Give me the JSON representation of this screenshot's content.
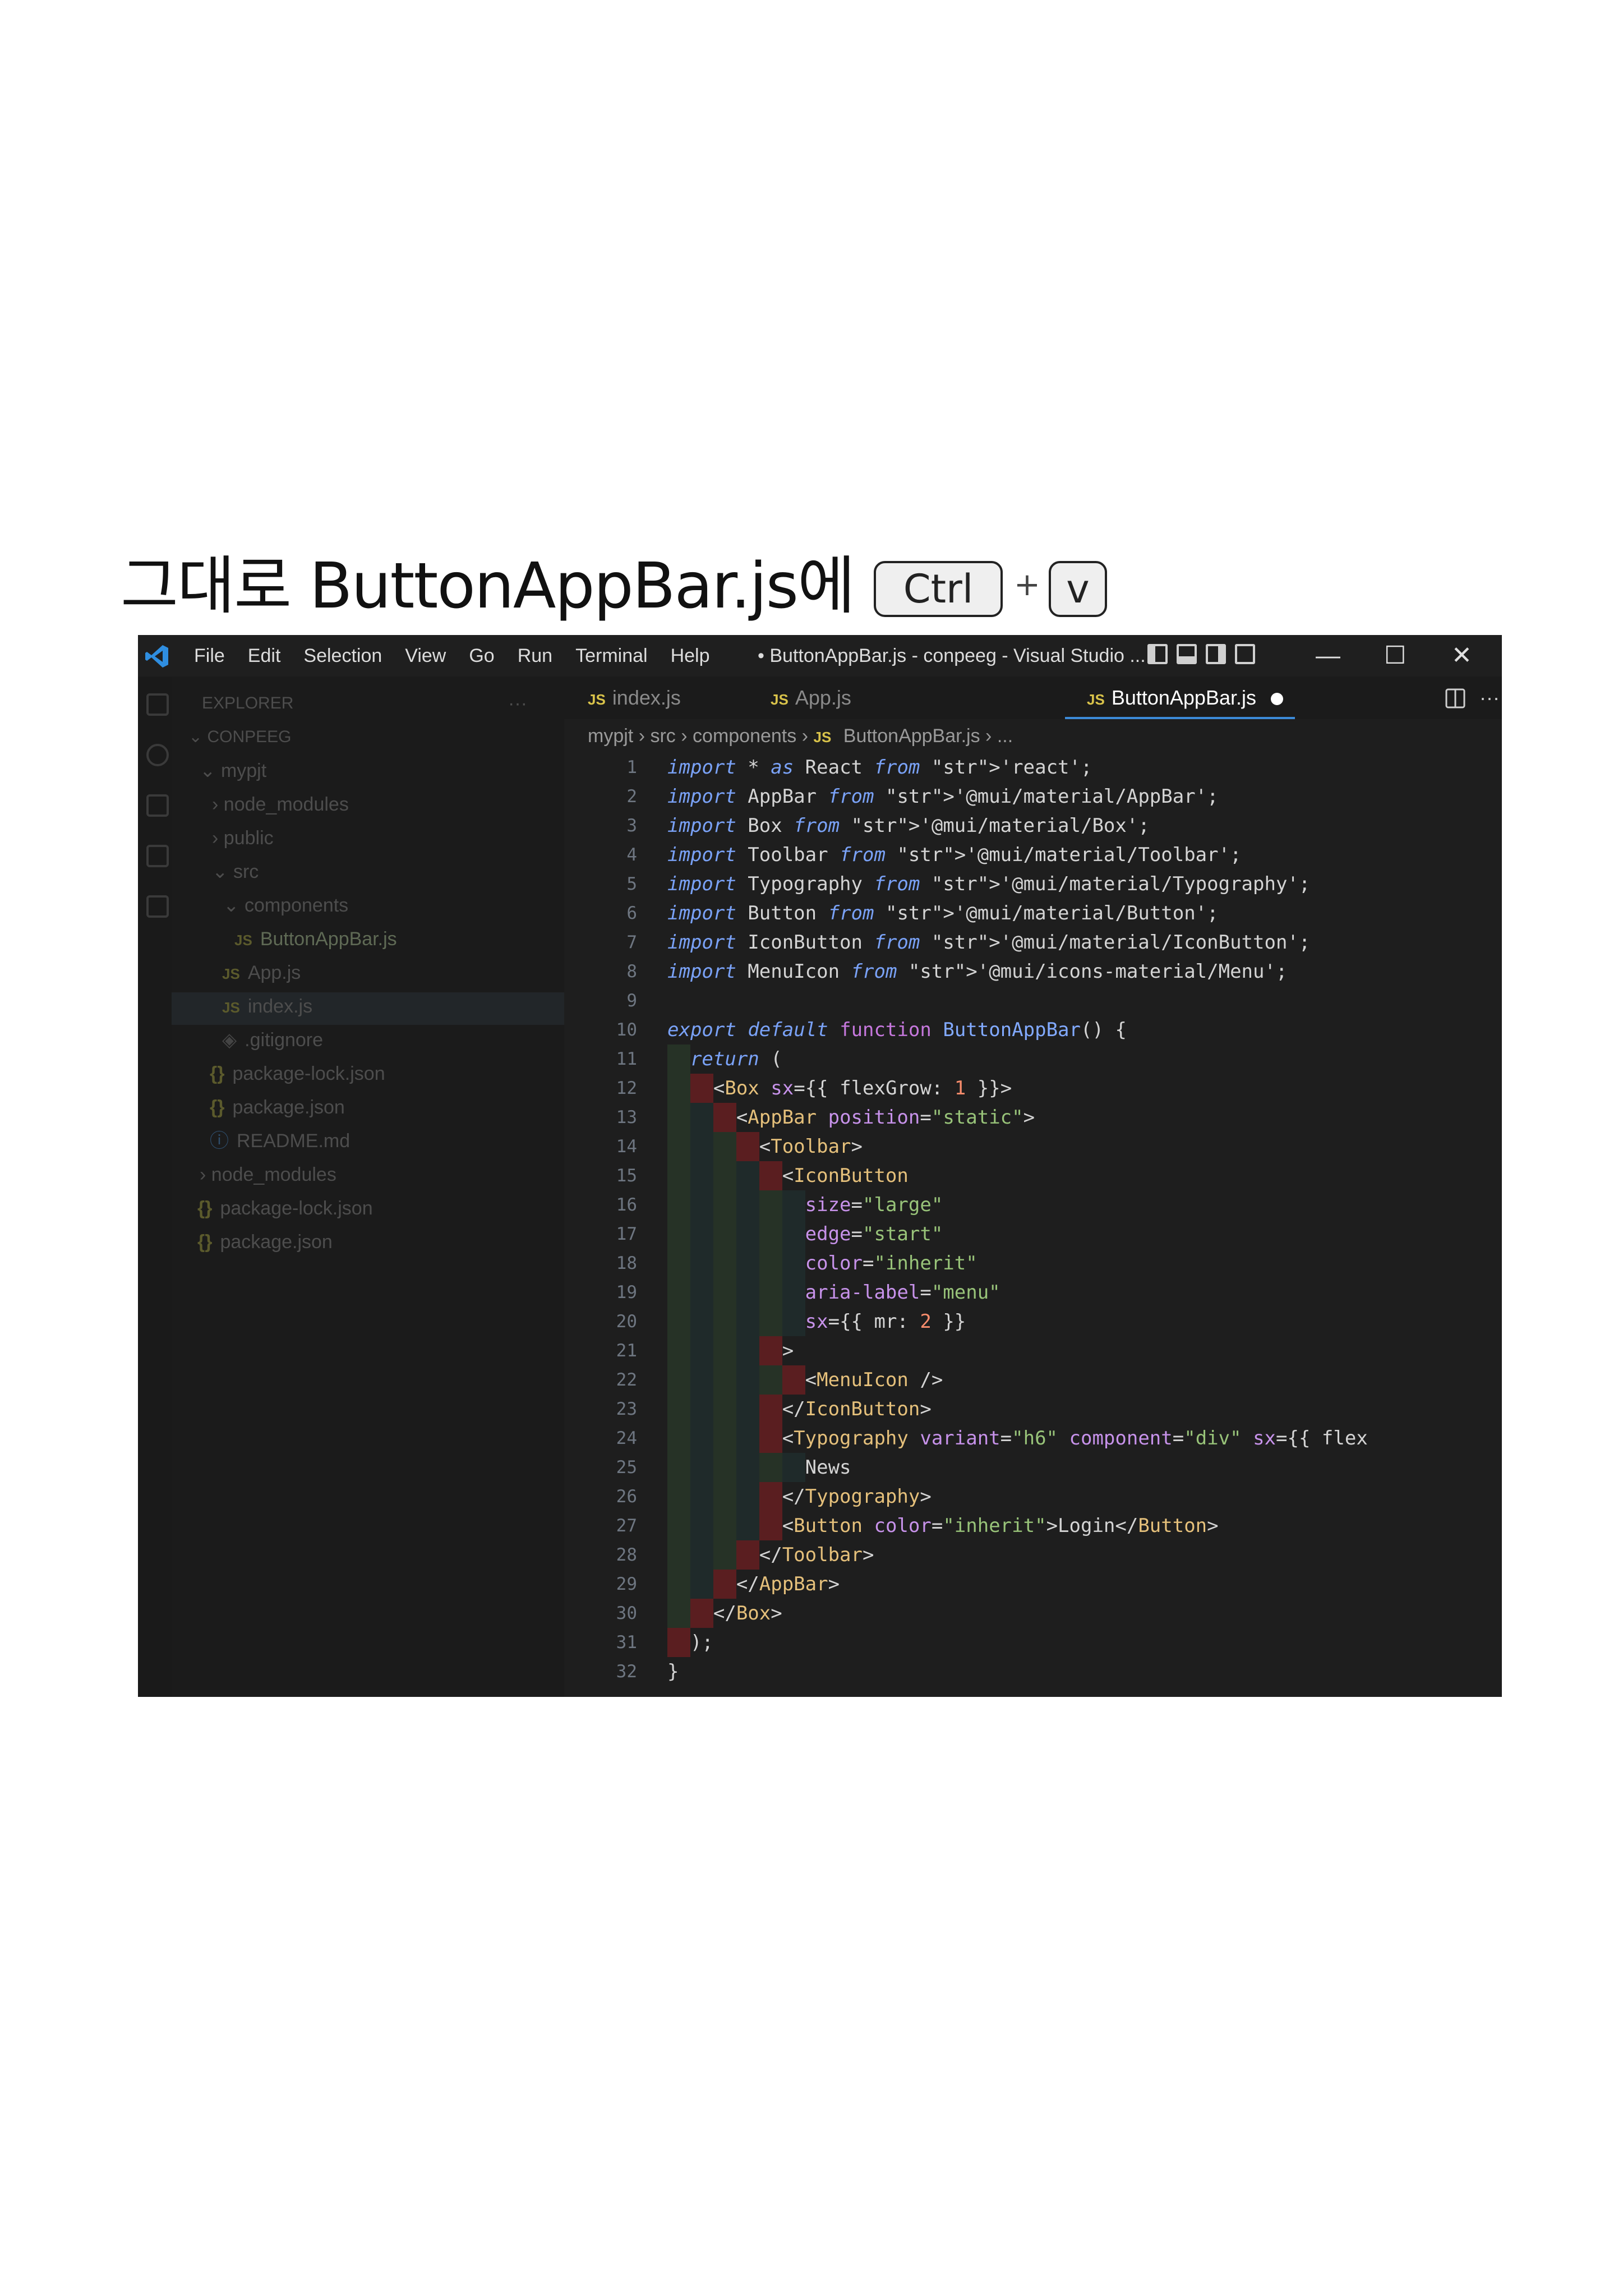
{
  "heading": {
    "text": "그대로 ButtonAppBar.js에",
    "key_ctrl": "Ctrl",
    "plus": "+",
    "key_v": "v"
  },
  "titlebar": {
    "menu": [
      "File",
      "Edit",
      "Selection",
      "View",
      "Go",
      "Run",
      "Terminal",
      "Help"
    ],
    "title": "• ButtonAppBar.js - conpeeg - Visual Studio ...",
    "minimize": "—",
    "maximize": "☐",
    "close": "✕"
  },
  "sidebar": {
    "header": "EXPLORER",
    "more": "···",
    "tree": [
      {
        "label": "CONPEEG",
        "prefix": "⌄"
      },
      {
        "label": "mypjt",
        "prefix": "⌄"
      },
      {
        "label": "node_modules",
        "prefix": "›"
      },
      {
        "label": "public",
        "prefix": "›"
      },
      {
        "label": "src",
        "prefix": "⌄"
      },
      {
        "label": "components",
        "prefix": "⌄"
      },
      {
        "label": "ButtonAppBar.js",
        "prefix": "JS"
      },
      {
        "label": "App.js",
        "prefix": "JS"
      },
      {
        "label": "index.js",
        "prefix": "JS"
      },
      {
        "label": ".gitignore",
        "prefix": "◈"
      },
      {
        "label": "package-lock.json",
        "prefix": "{}"
      },
      {
        "label": "package.json",
        "prefix": "{}"
      },
      {
        "label": "README.md",
        "prefix": "ⓘ"
      },
      {
        "label": "node_modules",
        "prefix": "›"
      },
      {
        "label": "package-lock.json",
        "prefix": "{}"
      },
      {
        "label": "package.json",
        "prefix": "{}"
      }
    ]
  },
  "tabs": [
    {
      "label": "index.js",
      "icon": "JS"
    },
    {
      "label": "App.js",
      "icon": "JS"
    },
    {
      "label": "ButtonAppBar.js",
      "icon": "JS"
    }
  ],
  "breadcrumb": {
    "parts": [
      "mypjt",
      "src",
      "components"
    ],
    "file_icon": "JS",
    "file": "ButtonAppBar.js",
    "tail": "..."
  },
  "editor": {
    "line_numbers": [
      "1",
      "2",
      "3",
      "4",
      "5",
      "6",
      "7",
      "8",
      "9",
      "10",
      "11",
      "12",
      "13",
      "14",
      "15",
      "16",
      "17",
      "18",
      "19",
      "20",
      "21",
      "22",
      "23",
      "24",
      "25",
      "26",
      "27",
      "28",
      "29",
      "30",
      "31",
      "32"
    ],
    "lines": [
      "import * as React from 'react';",
      "import AppBar from '@mui/material/AppBar';",
      "import Box from '@mui/material/Box';",
      "import Toolbar from '@mui/material/Toolbar';",
      "import Typography from '@mui/material/Typography';",
      "import Button from '@mui/material/Button';",
      "import IconButton from '@mui/material/IconButton';",
      "import MenuIcon from '@mui/icons-material/Menu';",
      "",
      "export default function ButtonAppBar() {",
      "  return (",
      "    <Box sx={{ flexGrow: 1 }}>",
      "      <AppBar position=\"static\">",
      "        <Toolbar>",
      "          <IconButton",
      "            size=\"large\"",
      "            edge=\"start\"",
      "            color=\"inherit\"",
      "            aria-label=\"menu\"",
      "            sx={{ mr: 2 }}",
      "          >",
      "            <MenuIcon />",
      "          </IconButton>",
      "          <Typography variant=\"h6\" component=\"div\" sx={{ flex",
      "            News",
      "          </Typography>",
      "          <Button color=\"inherit\">Login</Button>",
      "        </Toolbar>",
      "      </AppBar>",
      "    </Box>",
      "  );",
      "}"
    ]
  },
  "colors": {
    "window_bg": "#1e1e1e",
    "accent": "#3c8ad8",
    "indent_error": "#5a1e20",
    "indent_green": "#263226"
  }
}
